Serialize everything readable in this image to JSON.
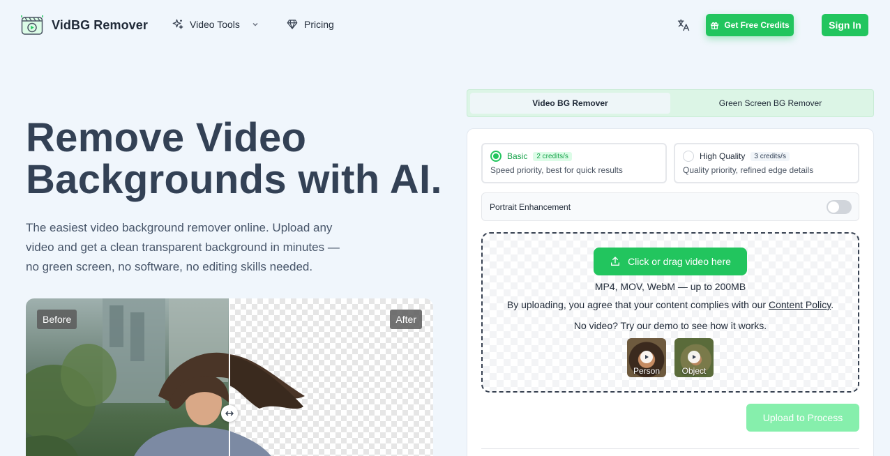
{
  "header": {
    "brand": "VidBG Remover",
    "nav": {
      "video_tools": "Video Tools",
      "pricing": "Pricing"
    },
    "get_free_credits": "Get Free Credits",
    "sign_in": "Sign In"
  },
  "hero": {
    "title_line1": "Remove Video",
    "title_line2": "Backgrounds with AI.",
    "subtitle": "The easiest video background remover online. Upload any video and get a clean transparent background in minutes — no green screen, no software, no editing skills needed.",
    "before_label": "Before",
    "after_label": "After"
  },
  "panel": {
    "tabs": [
      "Video BG Remover",
      "Green Screen BG Remover"
    ],
    "active_tab": "Video BG Remover",
    "quality_options": [
      {
        "title": "Basic",
        "credits": "2 credits/s",
        "desc": "Speed priority, best for quick results",
        "selected": true
      },
      {
        "title": "High Quality",
        "credits": "3 credits/s",
        "desc": "Quality priority, refined edge details",
        "selected": false
      }
    ],
    "portrait_enhancement": {
      "label": "Portrait Enhancement",
      "enabled": false
    },
    "upload": {
      "button": "Click or drag video here",
      "formats": "MP4, MOV, WebM — up to 200MB",
      "policy_prefix": "By uploading, you agree that your content complies with our ",
      "policy_link": "Content Policy",
      "policy_suffix": ".",
      "demo_prompt": "No video? Try our demo to see how it works.",
      "demos": [
        "Person",
        "Object"
      ]
    },
    "process_button": "Upload to Process"
  },
  "colors": {
    "accent": "#22c55e",
    "accent_disabled": "#86efac",
    "background": "#f0f6fc",
    "heading": "#334155"
  },
  "icons": [
    "logo-icon",
    "sparkles-icon",
    "chevron-down-icon",
    "diamond-icon",
    "translate-icon",
    "gift-icon",
    "upload-icon",
    "play-icon",
    "arrows-horizontal-icon"
  ]
}
